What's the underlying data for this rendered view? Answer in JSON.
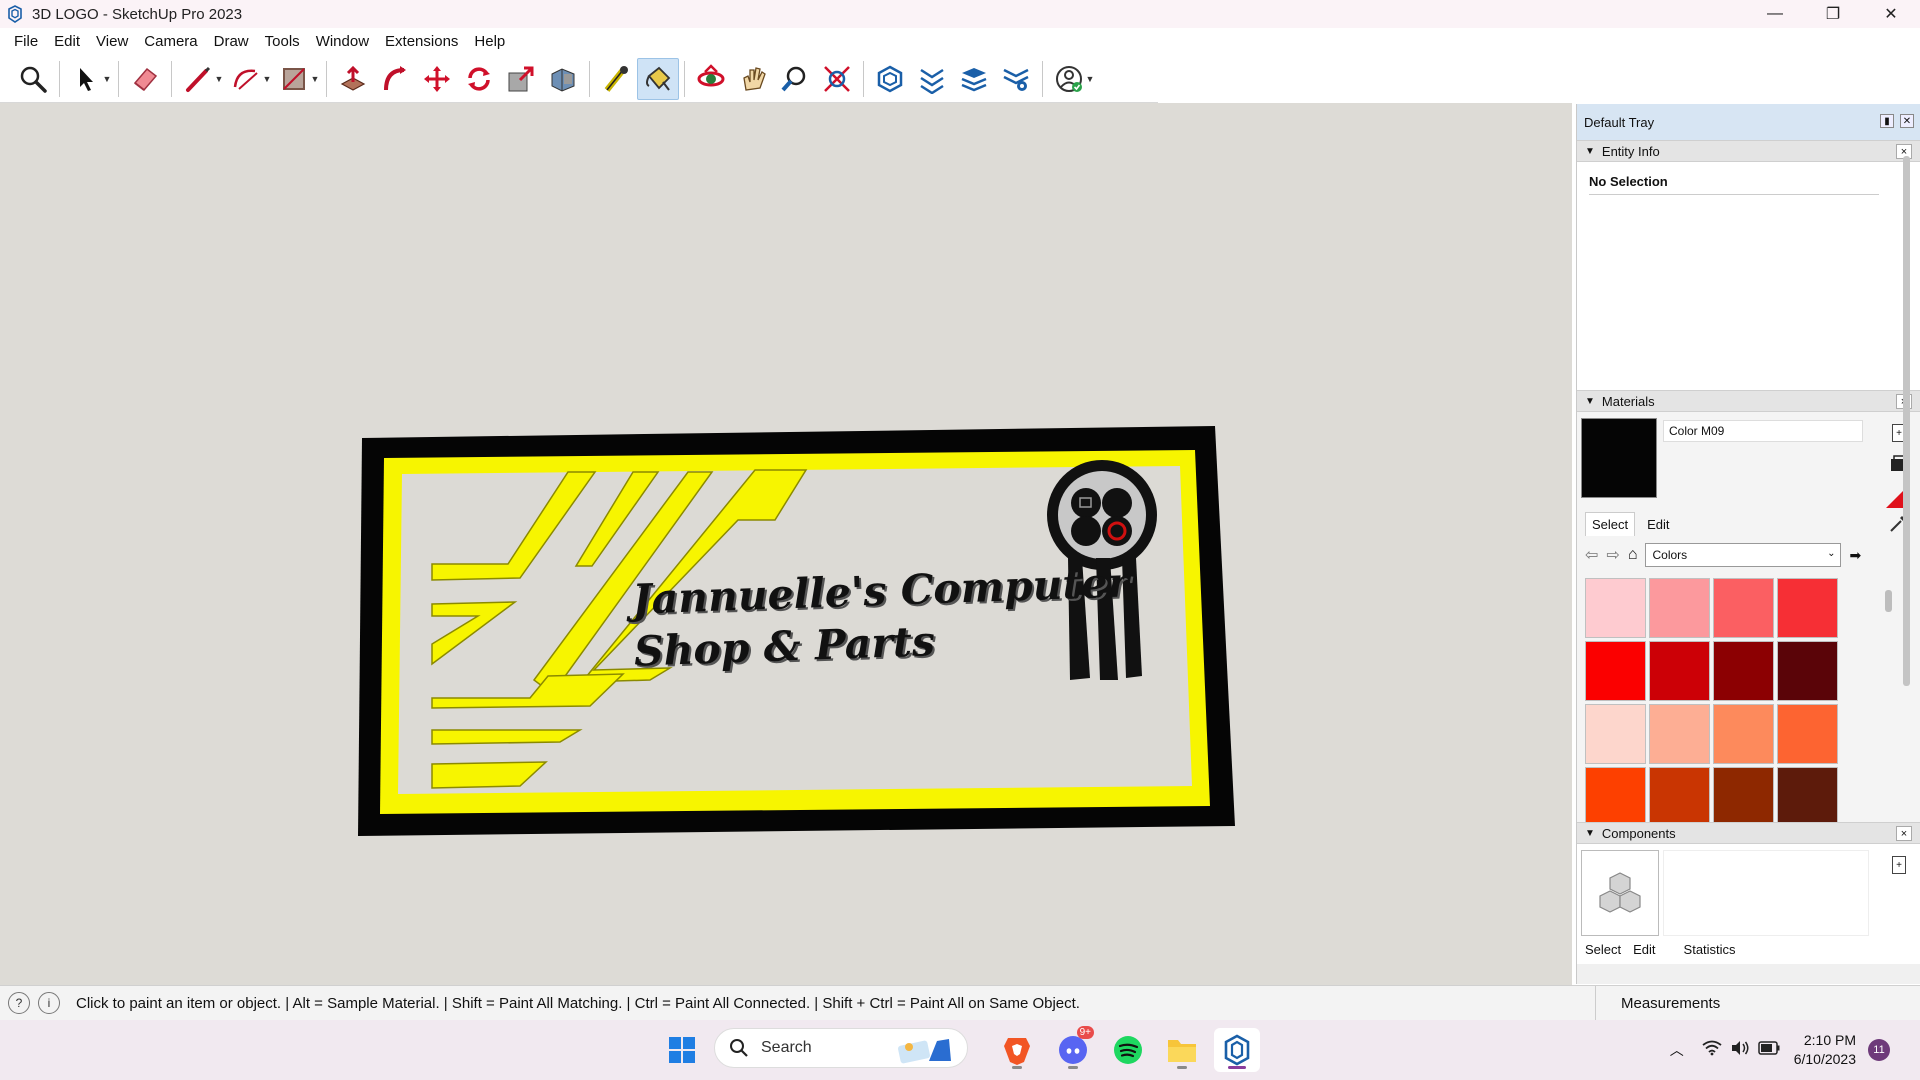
{
  "window": {
    "title": "3D LOGO  - SketchUp Pro 2023",
    "controls": [
      "minimize",
      "restore",
      "close"
    ]
  },
  "menu": [
    "File",
    "Edit",
    "View",
    "Camera",
    "Draw",
    "Tools",
    "Window",
    "Extensions",
    "Help"
  ],
  "toolbar": {
    "tools": [
      "zoom-tool",
      "select-tool",
      "eraser-tool",
      "line-tool",
      "arc-tool",
      "rectangle-tool",
      "push-pull-tool",
      "follow-me-tool",
      "move-tool",
      "rotate-tool",
      "scale-tool",
      "offset-tool",
      "tape-measure-tool",
      "paint-bucket-tool",
      "orbit-tool",
      "pan-tool",
      "zoom-window-tool",
      "zoom-extents-tool",
      "section-tool",
      "section-display-tool",
      "layers-tool",
      "model-settings-tool",
      "account-tool"
    ],
    "active_tool": "paint-bucket-tool"
  },
  "model": {
    "logo_line1": "Jannuelle's Computer",
    "logo_line2": "Shop & Parts"
  },
  "tray": {
    "title": "Default Tray",
    "entity_info": {
      "heading": "Entity Info",
      "selection": "No Selection"
    },
    "materials": {
      "heading": "Materials",
      "current_material": "Color M09",
      "tab_select": "Select",
      "tab_edit": "Edit",
      "library": "Colors",
      "swatches": [
        "#fecbd0",
        "#fc999d",
        "#fb5f62",
        "#f62f35",
        "#fb0000",
        "#cc0006",
        "#8c0002",
        "#5a0408",
        "#fdd6cc",
        "#fdae94",
        "#fd8a5c",
        "#fd6431",
        "#fd4000",
        "#c93502",
        "#8e2800",
        "#5d1b0b"
      ]
    },
    "components": {
      "heading": "Components",
      "tab_select": "Select",
      "tab_edit": "Edit",
      "tab_statistics": "Statistics"
    }
  },
  "status": {
    "hint": "Click to paint an item or object. | Alt = Sample Material. | Shift = Paint All Matching. | Ctrl = Paint All Connected. | Shift + Ctrl = Paint All on Same Object.",
    "measurements_label": "Measurements"
  },
  "taskbar": {
    "search_label": "Search",
    "discord_badge": "9+",
    "time": "2:10 PM",
    "date": "6/10/2023",
    "notification_count": "11"
  },
  "colors": {
    "viewport_bg": "#dddbd6",
    "logo_yellow": "#f7f500",
    "accent_active": "#cfe3f6"
  }
}
